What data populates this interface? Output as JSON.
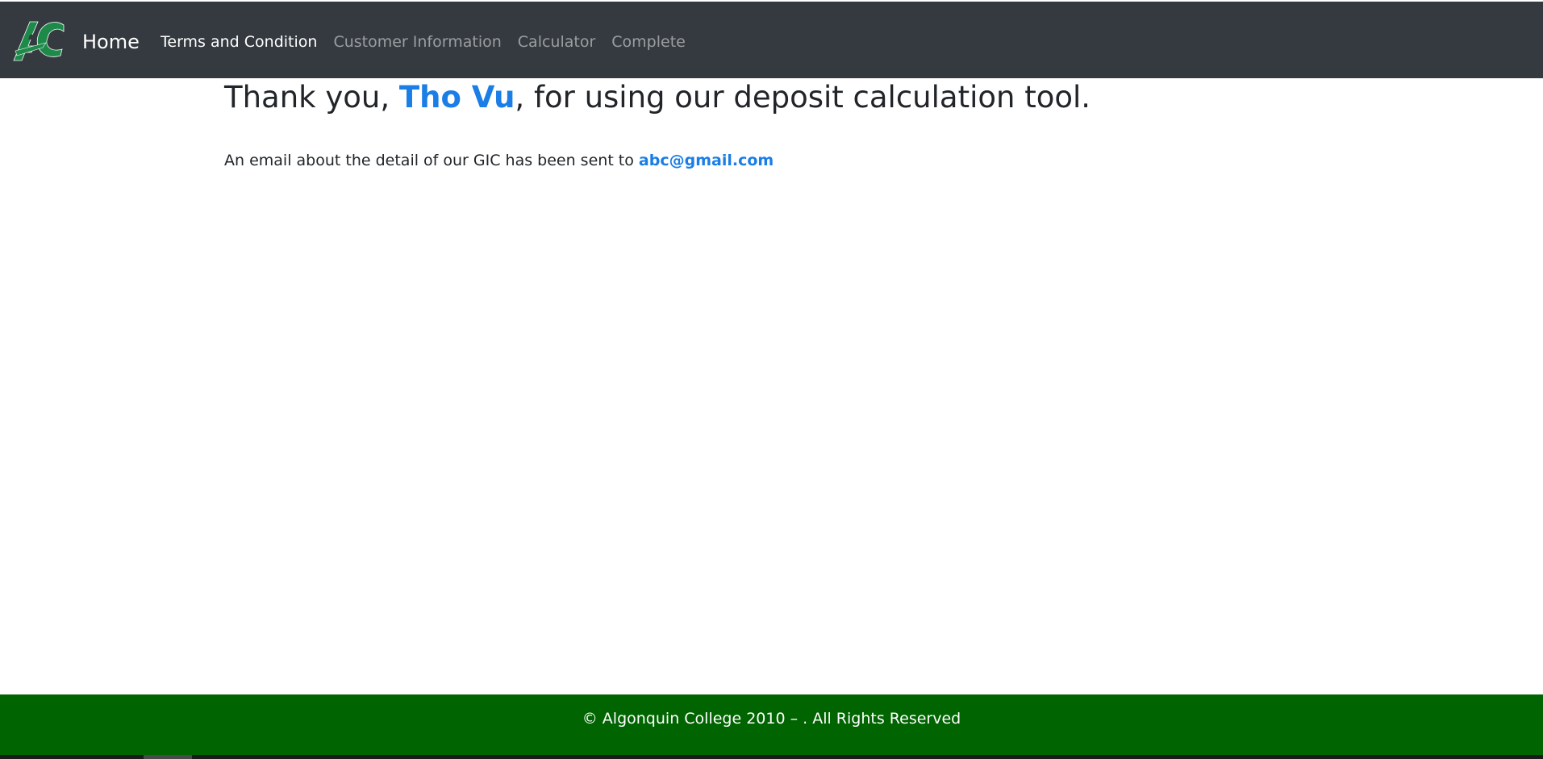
{
  "navbar": {
    "brand_label": "Home",
    "logo_icon": "algonquin-college-logo",
    "links": [
      {
        "label": "Terms and Condition",
        "active": true
      },
      {
        "label": "Customer Information",
        "active": false
      },
      {
        "label": "Calculator",
        "active": false
      },
      {
        "label": "Complete",
        "active": false
      }
    ]
  },
  "main": {
    "headline_prefix": "Thank you, ",
    "customer_name": "Tho Vu",
    "headline_suffix": ", for using our deposit calculation tool.",
    "email_prefix": "An email about the detail of our GIC has been sent to ",
    "email": "abc@gmail.com"
  },
  "footer": {
    "text": "© Algonquin College 2010 – . All Rights Reserved"
  },
  "colors": {
    "navbar_bg": "#343a40",
    "accent_blue": "#1a7ee6",
    "footer_bg": "#006400",
    "logo_green": "#1e8a4a"
  }
}
